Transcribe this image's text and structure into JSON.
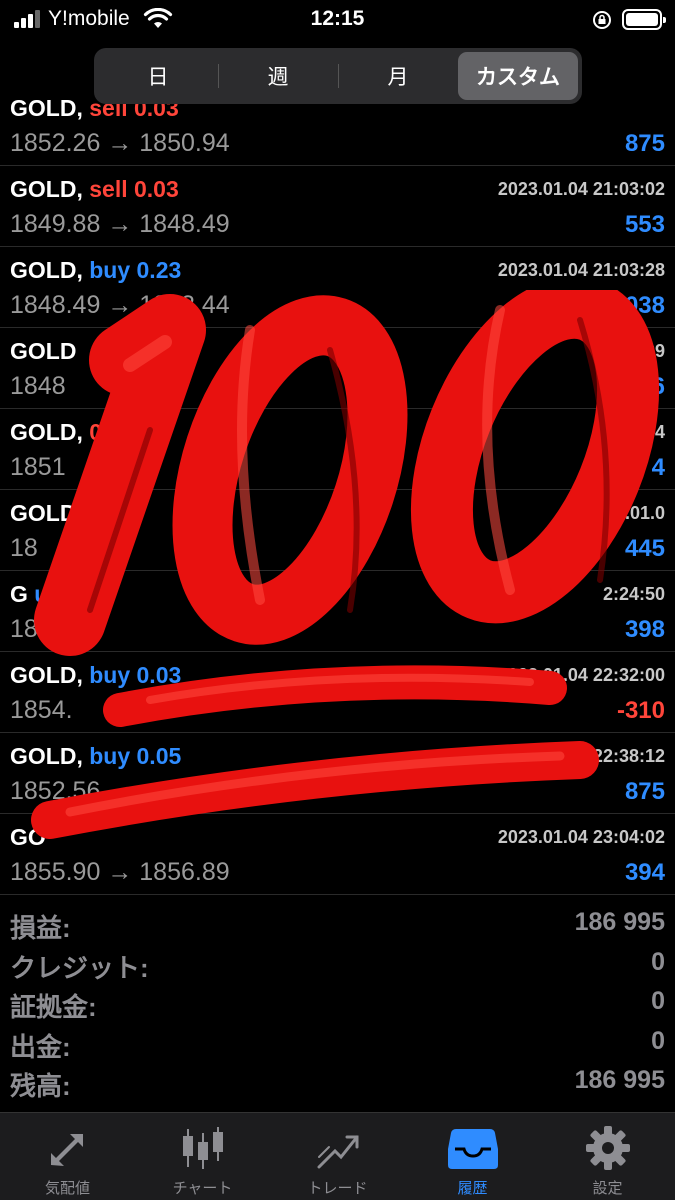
{
  "status_bar": {
    "carrier": "Y!mobile",
    "time": "12:15"
  },
  "segments": [
    "日",
    "週",
    "月",
    "カスタム"
  ],
  "active_segment": 3,
  "trades": [
    {
      "symbol": "GOLD,",
      "side": "sell",
      "side_label": "sell 0.03",
      "time": "",
      "prices": "1852.26 → 1850.94",
      "profit": "875"
    },
    {
      "symbol": "GOLD,",
      "side": "sell",
      "side_label": "sell 0.03",
      "time": "2023.01.04 21:03:02",
      "prices": "1849.88 → 1848.49",
      "profit": "553"
    },
    {
      "symbol": "GOLD,",
      "side": "buy",
      "side_label": "buy 0.23",
      "time": "2023.01.04 21:03:28",
      "prices": "1848.49 → 1852.44",
      "profit": "12 038"
    },
    {
      "symbol": "GOLD",
      "side": "buy",
      "side_label": "",
      "time": "21:03:29",
      "prices": "1848",
      "profit": "56"
    },
    {
      "symbol": "GOLD,",
      "side": "sell",
      "side_label": "05",
      "time": "3.01.04",
      "prices": "1851",
      "profit": "4"
    },
    {
      "symbol": "GOLD",
      "side": "buy",
      "side_label": "0.0",
      "time": "2023.01.0",
      "prices": "18",
      "profit": "445"
    },
    {
      "symbol": "G",
      "side": "buy",
      "side_label": "uy 0.03",
      "time": "2:24:50",
      "prices": "1854.",
      "profit": "398"
    },
    {
      "symbol": "GOLD,",
      "side": "buy",
      "side_label": "buy 0.03",
      "time": "2023.01.04 22:32:00",
      "prices": "1854.",
      "profit": "-310"
    },
    {
      "symbol": "GOLD,",
      "side": "buy",
      "side_label": "buy 0.05",
      "time": "2023.01.04 22:38:12",
      "prices": "1852.56",
      "profit": "875"
    },
    {
      "symbol": "GO",
      "side": "buy",
      "side_label": "",
      "time": "2023.01.04 23:04:02",
      "prices": "1855.90 → 1856.89",
      "profit": "394"
    }
  ],
  "summary": [
    {
      "label": "損益:",
      "value": "186 995"
    },
    {
      "label": "クレジット:",
      "value": "0"
    },
    {
      "label": "証拠金:",
      "value": "0"
    },
    {
      "label": "出金:",
      "value": "0"
    },
    {
      "label": "残高:",
      "value": "186 995"
    }
  ],
  "tabs": [
    {
      "label": "気配値",
      "icon": "quotes-arrows-icon"
    },
    {
      "label": "チャート",
      "icon": "candlestick-chart-icon"
    },
    {
      "label": "トレード",
      "icon": "trade-trend-icon"
    },
    {
      "label": "履歴",
      "icon": "history-inbox-icon"
    },
    {
      "label": "設定",
      "icon": "settings-gear-icon"
    }
  ],
  "active_tab": 3,
  "overlay": {
    "icon": "hundred-points-emoji-icon"
  },
  "colors": {
    "sell": "#ff453a",
    "buy": "#2f8cff",
    "active_tab": "#2f8cff"
  }
}
